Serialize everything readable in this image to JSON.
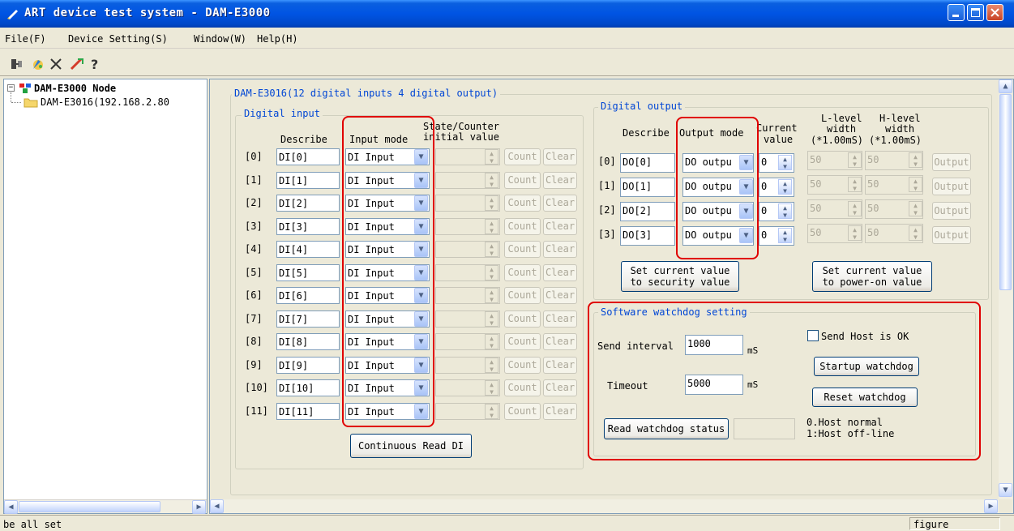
{
  "window": {
    "title": "ART device test system - DAM-E3000"
  },
  "menu": [
    "File(F)",
    "Device Setting(S)",
    "Window(W)",
    "Help(H)"
  ],
  "toolbar": {
    "icons": [
      "connect-icon",
      "paint-icon",
      "disconnect-icon",
      "wizard-icon",
      "help-icon"
    ]
  },
  "tree": {
    "root": "DAM-E3000 Node",
    "child": "DAM-E3016(192.168.2.80"
  },
  "module": {
    "title": "DAM-E3016(12 digital inputs  4 digital output)"
  },
  "digital_input": {
    "group_label": "Digital input",
    "col_describe": "Describe",
    "col_mode": "Input mode",
    "col_state_1": "State/Counter",
    "col_state_2": "initial value",
    "count_label": "Count",
    "clear_label": "Clear",
    "rows": [
      {
        "idx": "[0]",
        "name": "DI[0]",
        "mode": "DI Input"
      },
      {
        "idx": "[1]",
        "name": "DI[1]",
        "mode": "DI Input"
      },
      {
        "idx": "[2]",
        "name": "DI[2]",
        "mode": "DI Input"
      },
      {
        "idx": "[3]",
        "name": "DI[3]",
        "mode": "DI Input"
      },
      {
        "idx": "[4]",
        "name": "DI[4]",
        "mode": "DI Input"
      },
      {
        "idx": "[5]",
        "name": "DI[5]",
        "mode": "DI Input"
      },
      {
        "idx": "[6]",
        "name": "DI[6]",
        "mode": "DI Input"
      },
      {
        "idx": "[7]",
        "name": "DI[7]",
        "mode": "DI Input"
      },
      {
        "idx": "[8]",
        "name": "DI[8]",
        "mode": "DI Input"
      },
      {
        "idx": "[9]",
        "name": "DI[9]",
        "mode": "DI Input"
      },
      {
        "idx": "[10]",
        "name": "DI[10]",
        "mode": "DI Input"
      },
      {
        "idx": "[11]",
        "name": "DI[11]",
        "mode": "DI Input"
      }
    ],
    "continuous_button": "Continuous Read DI"
  },
  "digital_output": {
    "group_label": "Digital output",
    "col_describe": "Describe",
    "col_mode": "Output mode",
    "col_current_1": "Current",
    "col_current_2": "value",
    "col_l_1": "L-level",
    "col_l_2": "width",
    "col_l_3": "(*1.00mS)",
    "col_h_1": "H-level",
    "col_h_2": "width",
    "col_h_3": "(*1.00mS)",
    "output_label": "Output",
    "rows": [
      {
        "idx": "[0]",
        "name": "DO[0]",
        "mode": "DO outpu",
        "current": "0",
        "l": "50",
        "h": "50"
      },
      {
        "idx": "[1]",
        "name": "DO[1]",
        "mode": "DO outpu",
        "current": "0",
        "l": "50",
        "h": "50"
      },
      {
        "idx": "[2]",
        "name": "DO[2]",
        "mode": "DO outpu",
        "current": "0",
        "l": "50",
        "h": "50"
      },
      {
        "idx": "[3]",
        "name": "DO[3]",
        "mode": "DO outpu",
        "current": "0",
        "l": "50",
        "h": "50"
      }
    ],
    "security_btn_1": "Set current value",
    "security_btn_2": "to security value",
    "poweron_btn_1": "Set current value",
    "poweron_btn_2": "to power-on value"
  },
  "watchdog": {
    "group_label": "Software watchdog setting",
    "send_interval_label": "Send interval",
    "send_interval_value": "1000",
    "ms_1": "mS",
    "timeout_label": "Timeout",
    "timeout_value": "5000",
    "ms_2": "mS",
    "send_host_ok": "Send Host is OK",
    "startup_button": "Startup watchdog",
    "reset_button": "Reset watchdog",
    "read_status_button": "Read watchdog status",
    "legend_1": "0.Host normal",
    "legend_2": "1:Host off-line"
  },
  "status": {
    "left": "be all set",
    "right": "figure"
  }
}
